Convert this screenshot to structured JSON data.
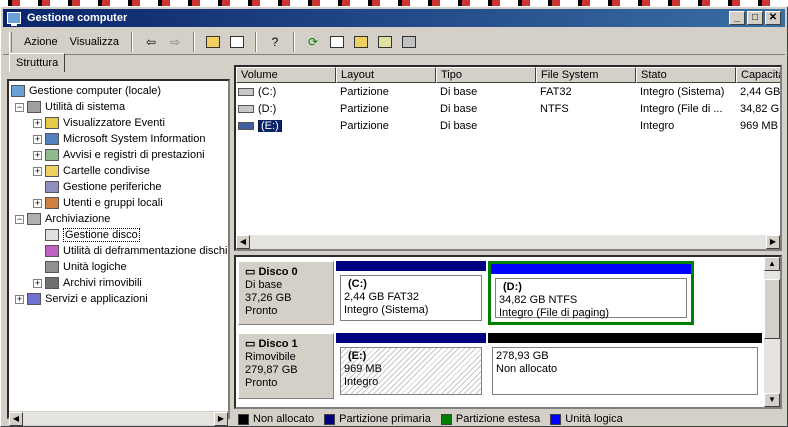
{
  "window": {
    "title": "Gestione computer"
  },
  "titlebar_buttons": {
    "minimize": "_",
    "maximize": "□",
    "close": "✕"
  },
  "menu": {
    "action": "Azione",
    "view": "Visualizza"
  },
  "tabs": {
    "structure": "Struttura"
  },
  "toolbar_icons": [
    "back-icon",
    "forward-icon",
    "up-folder-icon",
    "show-tree-icon",
    "help-icon",
    "refresh-icon",
    "properties-icon",
    "open-icon",
    "find-icon",
    "settings-icon"
  ],
  "tree": {
    "root": "Gestione computer (locale)",
    "system_tools": "Utilità di sistema",
    "event_viewer": "Visualizzatore Eventi",
    "msinfo": "Microsoft System Information",
    "perf_logs": "Avvisi e registri di prestazioni",
    "shared_folders": "Cartelle condivise",
    "device_manager": "Gestione periferiche",
    "local_users": "Utenti e gruppi locali",
    "storage": "Archiviazione",
    "disk_management": "Gestione disco",
    "defrag": "Utilità di deframmentazione dischi",
    "logical_drives": "Unità logiche",
    "removable_storage": "Archivi rimovibili",
    "services_apps": "Servizi e applicazioni"
  },
  "volume_list": {
    "columns": [
      "Volume",
      "Layout",
      "Tipo",
      "File System",
      "Stato",
      "Capacità"
    ],
    "rows": [
      {
        "volume": "(C:)",
        "layout": "Partizione",
        "type": "Di base",
        "fs": "FAT32",
        "status": "Integro (Sistema)",
        "capacity": "2,44 GB"
      },
      {
        "volume": "(D:)",
        "layout": "Partizione",
        "type": "Di base",
        "fs": "NTFS",
        "status": "Integro (File di ...",
        "capacity": "34,82 GB"
      },
      {
        "volume": "(E:)",
        "layout": "Partizione",
        "type": "Di base",
        "fs": "",
        "status": "Integro",
        "capacity": "969 MB"
      }
    ]
  },
  "disks": [
    {
      "name": "Disco 0",
      "type": "Di base",
      "size": "37,26 GB",
      "status": "Pronto",
      "partitions": [
        {
          "name": "(C:)",
          "size": "2,44 GB FAT32",
          "status": "Integro (Sistema)"
        },
        {
          "name": "(D:)",
          "size": "34,82 GB NTFS",
          "status": "Integro (File di paging)"
        }
      ]
    },
    {
      "name": "Disco 1",
      "type": "Rimovibile",
      "size": "279,87 GB",
      "status": "Pronto",
      "partitions": [
        {
          "name": "(E:)",
          "size": "969 MB",
          "status": "Integro"
        },
        {
          "name": "",
          "size": "278,93 GB",
          "status": "Non allocato"
        }
      ]
    }
  ],
  "legend": [
    {
      "label": "Non allocato",
      "color": "#000000"
    },
    {
      "label": "Partizione primaria",
      "color": "#000080"
    },
    {
      "label": "Partizione estesa",
      "color": "#008000"
    },
    {
      "label": "Unità logica",
      "color": "#0000ff"
    }
  ],
  "colors": {
    "title_bar": "#0a246a",
    "primary": "#000080",
    "extended": "#008000",
    "logical": "#0000ff",
    "unallocated": "#000000"
  }
}
